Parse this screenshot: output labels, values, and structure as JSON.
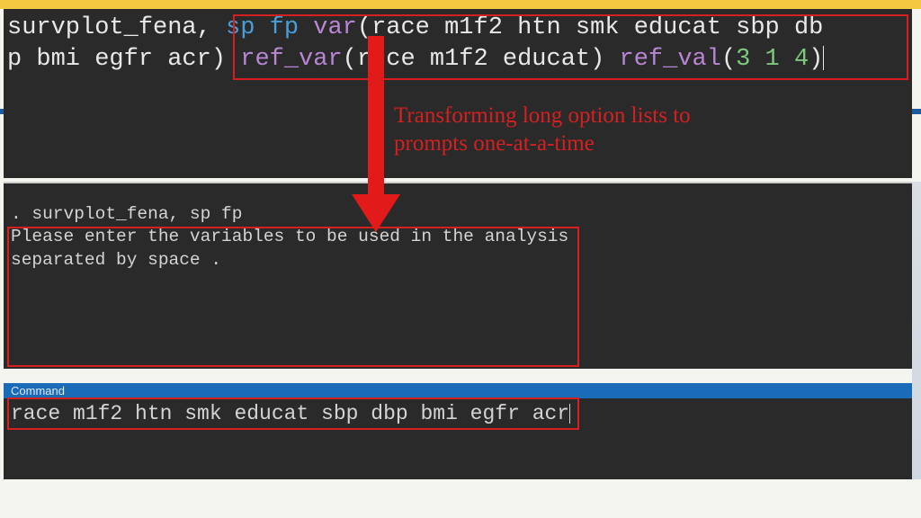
{
  "top_command": {
    "cmd": "survplot_fena,",
    "opt1": "sp",
    "opt2": "fp",
    "var_kw": "var",
    "var_open": "(",
    "var_args1": "race m1f2 htn smk educat sbp db",
    "var_args2a": "p bmi egfr acr",
    "var_close2": ")",
    "refvar_kw": "ref_var",
    "refvar_open": "(",
    "refvar_args": "r  ce m1f2 educat",
    "refvar_close": ")",
    "refval_kw": "ref_val",
    "refval_open": "(",
    "refval_args": "3 1 4",
    "refval_close": ")"
  },
  "annotation": {
    "line1": "Transforming long option lists to",
    "line2": "prompts one-at-a-time"
  },
  "mid": {
    "prompt": ". survplot_fena, sp fp",
    "msg1": "Please enter the variables to be used in the analysis",
    "msg2": "separated by space ."
  },
  "command_bar": "Command",
  "input_line": "race m1f2 htn smk educat sbp dbp bmi egfr acr"
}
